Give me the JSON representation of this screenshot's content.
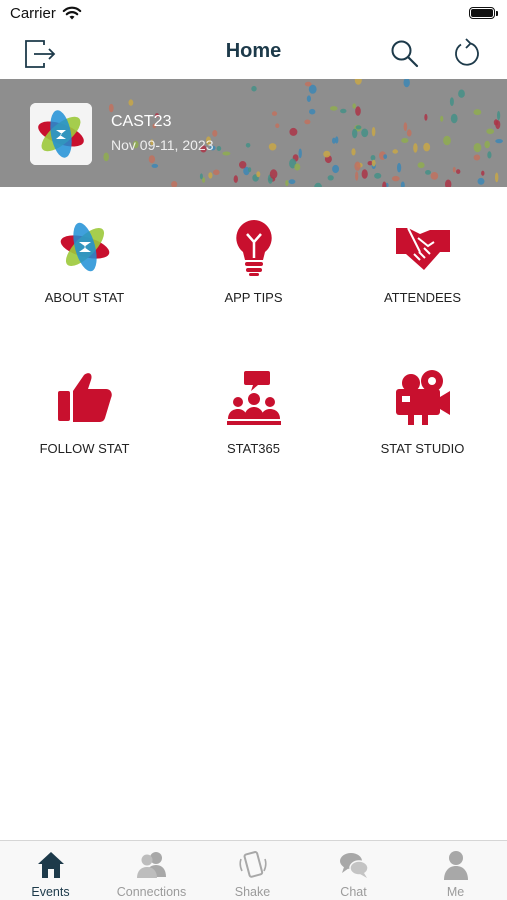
{
  "status_bar": {
    "carrier": "Carrier"
  },
  "nav": {
    "title": "Home",
    "logout_icon": "logout-icon",
    "search_icon": "search-icon",
    "refresh_icon": "refresh-icon"
  },
  "event": {
    "name": "CAST23",
    "dates": "Nov 09-11, 2023"
  },
  "tiles": [
    {
      "label": "ABOUT STAT",
      "icon": "stat-logo-icon"
    },
    {
      "label": "APP TIPS",
      "icon": "lightbulb-icon"
    },
    {
      "label": "ATTENDEES",
      "icon": "handshake-icon"
    },
    {
      "label": "FOLLOW STAT",
      "icon": "thumbs-up-icon"
    },
    {
      "label": "STAT365",
      "icon": "group-chat-icon"
    },
    {
      "label": "STAT STUDIO",
      "icon": "video-camera-icon"
    }
  ],
  "tabs": [
    {
      "label": "Events",
      "icon": "home-icon",
      "active": true
    },
    {
      "label": "Connections",
      "icon": "people-icon",
      "active": false
    },
    {
      "label": "Shake",
      "icon": "phone-shake-icon",
      "active": false
    },
    {
      "label": "Chat",
      "icon": "chat-bubbles-icon",
      "active": false
    },
    {
      "label": "Me",
      "icon": "person-icon",
      "active": false
    }
  ],
  "colors": {
    "accent_red": "#c8102e",
    "nav_dark": "#1d3a4a",
    "tab_inactive": "#9b9b9b"
  }
}
